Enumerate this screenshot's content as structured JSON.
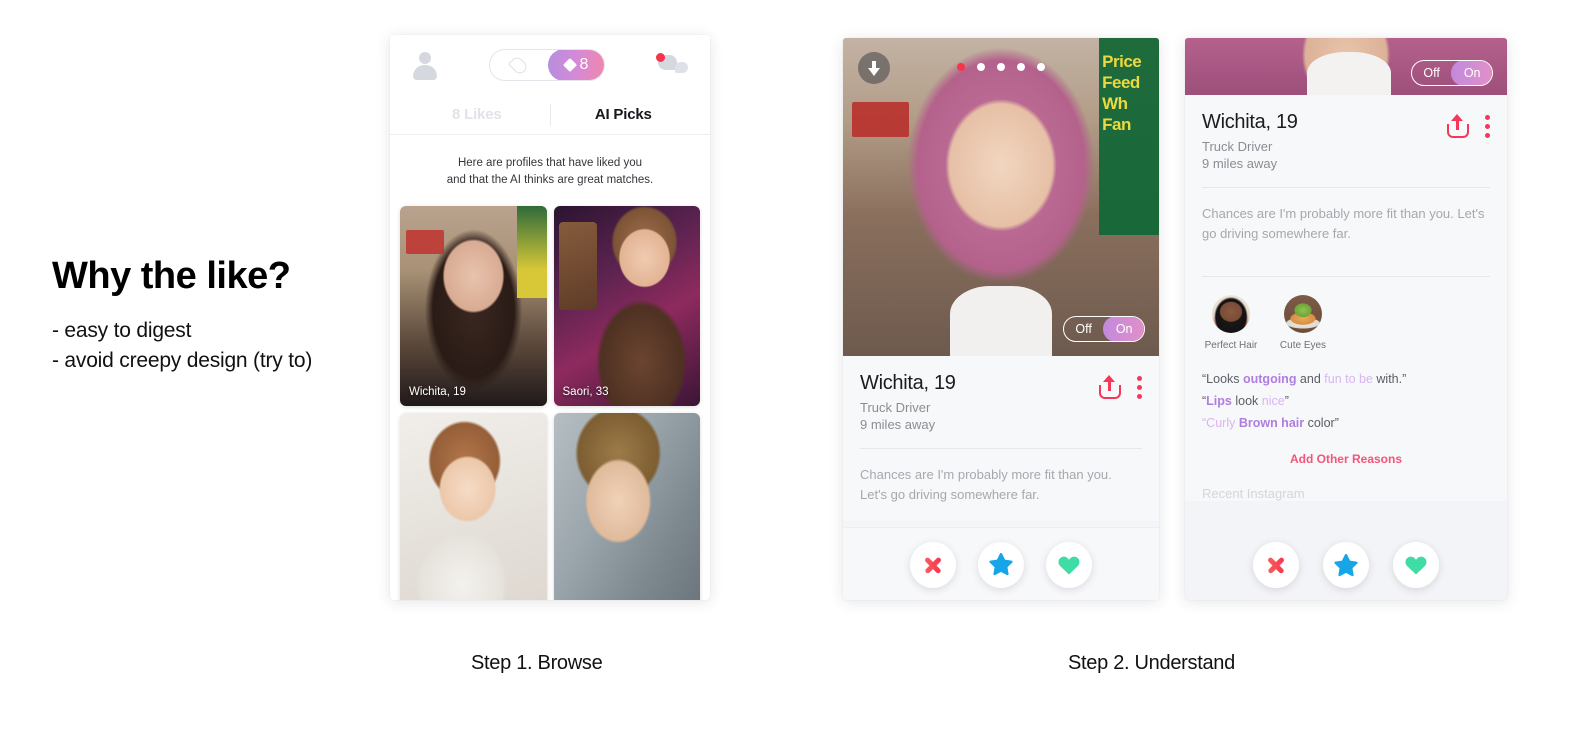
{
  "headline": {
    "title": "Why the like?",
    "bullets": [
      "- easy to digest",
      "- avoid creepy design (try to)"
    ]
  },
  "captions": {
    "step1": "Step 1. Browse",
    "step2": "Step 2. Understand"
  },
  "phone1": {
    "nav": {
      "profile_icon": "person-icon",
      "flame_icon": "flame-icon",
      "diamond_icon": "diamond-icon",
      "super_like_count": "8",
      "chat_icon": "chat-icon",
      "notification_dot": true
    },
    "tabs": [
      {
        "label": "8 Likes",
        "active": false
      },
      {
        "label": "AI Picks",
        "active": true
      }
    ],
    "description_line1": "Here are profiles that have liked you",
    "description_line2": "and that the AI thinks are great matches.",
    "cards": [
      {
        "label": "Wichita, 19"
      },
      {
        "label": "Saori, 33"
      },
      {
        "label": ""
      },
      {
        "label": ""
      }
    ]
  },
  "phone2": {
    "download_icon": "download-arrow-icon",
    "photo_dots": {
      "count": 5,
      "active_index": 0
    },
    "toggle": {
      "off_label": "Off",
      "on_label": "On",
      "state": "on"
    },
    "profile": {
      "name": "Wichita, 19",
      "job": "Truck Driver",
      "distance": "9 miles away",
      "share_icon": "share-icon",
      "more_icon": "kebab-menu-icon"
    },
    "bio": "Chances are I'm probably more fit than you. Let's go driving somewhere far.",
    "actions": [
      {
        "name": "nope-button",
        "icon": "x-icon"
      },
      {
        "name": "super-like-button",
        "icon": "star-icon"
      },
      {
        "name": "like-button",
        "icon": "heart-icon"
      }
    ]
  },
  "phone3": {
    "toggle": {
      "off_label": "Off",
      "on_label": "On",
      "state": "on"
    },
    "profile": {
      "name": "Wichita, 19",
      "job": "Truck Driver",
      "distance": "9 miles away",
      "share_icon": "share-icon",
      "more_icon": "kebab-menu-icon"
    },
    "bio": "Chances are I'm probably more fit than you. Let's go driving somewhere far.",
    "tags": [
      {
        "caption": "Perfect Hair",
        "avatar": "person-avatar"
      },
      {
        "caption": "Cute Eyes",
        "avatar": "food-bowl-avatar"
      }
    ],
    "reasons": [
      {
        "parts": [
          {
            "t": "“Looks ",
            "s": "plain"
          },
          {
            "t": "outgoing",
            "s": "bold"
          },
          {
            "t": " and ",
            "s": "plain"
          },
          {
            "t": "fun to be",
            "s": "light"
          },
          {
            "t": " with.”",
            "s": "plain"
          }
        ]
      },
      {
        "parts": [
          {
            "t": "“",
            "s": "plain"
          },
          {
            "t": "Lips",
            "s": "bold"
          },
          {
            "t": " look ",
            "s": "plain"
          },
          {
            "t": "nice",
            "s": "light"
          },
          {
            "t": "”",
            "s": "plain"
          }
        ]
      },
      {
        "parts": [
          {
            "t": "“",
            "s": "light"
          },
          {
            "t": "Curly ",
            "s": "light"
          },
          {
            "t": "Brown hair",
            "s": "bold"
          },
          {
            "t": " color”",
            "s": "plain"
          }
        ]
      }
    ],
    "add_reasons": "Add Other Reasons",
    "recent_label": "Recent Instagram",
    "actions": [
      {
        "name": "nope-button",
        "icon": "x-icon"
      },
      {
        "name": "super-like-button",
        "icon": "star-icon"
      },
      {
        "name": "like-button",
        "icon": "heart-icon"
      }
    ]
  },
  "colors": {
    "accent_pink": "#f5375a",
    "purple_bold": "#b07de0",
    "purple_light": "#d8b6f0",
    "like_green": "#3fdca6",
    "super_blue": "#16a6e8",
    "add_reasons_pink": "#f2557a"
  }
}
